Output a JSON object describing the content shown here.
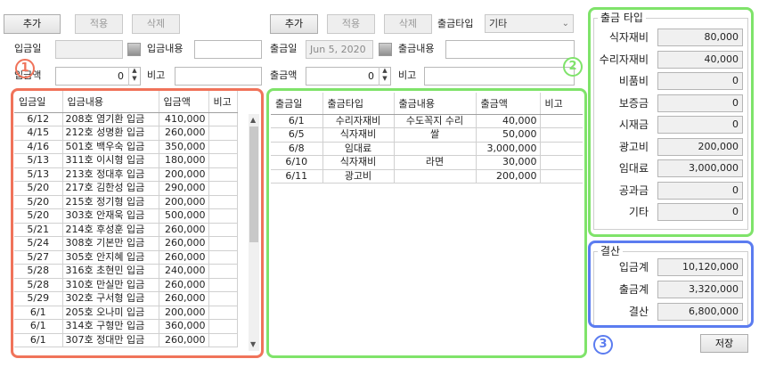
{
  "deposit_toolbar": {
    "add": "추가",
    "apply": "적용",
    "delete": "삭제"
  },
  "withdraw_toolbar": {
    "add": "추가",
    "apply": "적용",
    "delete": "삭제",
    "type_label": "출금타입",
    "type_value": "기타"
  },
  "deposit_form": {
    "date_label": "입금일",
    "date_value": "",
    "content_label": "입금내용",
    "content_value": "",
    "amount_label": "입금액",
    "amount_value": "0",
    "memo_label": "비고",
    "memo_value": ""
  },
  "withdraw_form": {
    "date_label": "출금일",
    "date_value": "Jun  5, 2020",
    "content_label": "출금내용",
    "content_value": "",
    "amount_label": "출금액",
    "amount_value": "0",
    "memo_label": "비고",
    "memo_value": ""
  },
  "deposit_table": {
    "headers": [
      "입금일",
      "입금내용",
      "입금액",
      "비고"
    ],
    "rows": [
      [
        "6/12",
        "208호 염기환 입금",
        "410,000",
        ""
      ],
      [
        "4/15",
        "212호 성명환 입금",
        "260,000",
        ""
      ],
      [
        "4/16",
        "501호 백우숙 입금",
        "350,000",
        ""
      ],
      [
        "5/13",
        "311호 이시형 입금",
        "180,000",
        ""
      ],
      [
        "5/13",
        "213호 정대후 입금",
        "200,000",
        ""
      ],
      [
        "5/20",
        "217호 김한성 입금",
        "290,000",
        ""
      ],
      [
        "5/20",
        "215호 정기형 입금",
        "200,000",
        ""
      ],
      [
        "5/20",
        "303호 안재욱 입금",
        "500,000",
        ""
      ],
      [
        "5/21",
        "214호 후성훈 입금",
        "260,000",
        ""
      ],
      [
        "5/24",
        "308호 기본만 입금",
        "260,000",
        ""
      ],
      [
        "5/27",
        "305호 안지혜 입금",
        "260,000",
        ""
      ],
      [
        "5/28",
        "316호 초현민 입금",
        "240,000",
        ""
      ],
      [
        "5/28",
        "310호 만실만 입금",
        "260,000",
        ""
      ],
      [
        "5/29",
        "302호 구서형 입금",
        "260,000",
        ""
      ],
      [
        "6/1",
        "205호 오나미 입금",
        "200,000",
        ""
      ],
      [
        "6/1",
        "314호 구형만 입금",
        "360,000",
        ""
      ],
      [
        "6/1",
        "307호 정대만 입금",
        "260,000",
        ""
      ]
    ]
  },
  "withdraw_table": {
    "headers": [
      "출금일",
      "출금타입",
      "출금내용",
      "출금액",
      "비고"
    ],
    "rows": [
      [
        "6/1",
        "수리자재비",
        "수도꼭지 수리",
        "40,000",
        ""
      ],
      [
        "6/5",
        "식자재비",
        "쌀",
        "50,000",
        ""
      ],
      [
        "6/8",
        "임대료",
        "",
        "3,000,000",
        ""
      ],
      [
        "6/10",
        "식자재비",
        "라면",
        "30,000",
        ""
      ],
      [
        "6/11",
        "광고비",
        "",
        "200,000",
        ""
      ]
    ]
  },
  "withdraw_types": {
    "title": "출금 타입",
    "items": [
      {
        "label": "식자재비",
        "value": "80,000"
      },
      {
        "label": "수리자재비",
        "value": "40,000"
      },
      {
        "label": "비품비",
        "value": "0"
      },
      {
        "label": "보증금",
        "value": "0"
      },
      {
        "label": "시재금",
        "value": "0"
      },
      {
        "label": "광고비",
        "value": "200,000"
      },
      {
        "label": "임대료",
        "value": "3,000,000"
      },
      {
        "label": "공과금",
        "value": "0"
      },
      {
        "label": "기타",
        "value": "0"
      }
    ]
  },
  "settlement": {
    "title": "결산",
    "items": [
      {
        "label": "입금계",
        "value": "10,120,000"
      },
      {
        "label": "출금계",
        "value": "3,320,000"
      },
      {
        "label": "결산",
        "value": "6,800,000"
      }
    ]
  },
  "save_label": "저장",
  "badges": {
    "one": "1",
    "two": "2",
    "three": "3"
  },
  "colors": {
    "badge1": "#f0735a",
    "badge2": "#7fe36a",
    "badge3": "#5b7cf0"
  }
}
